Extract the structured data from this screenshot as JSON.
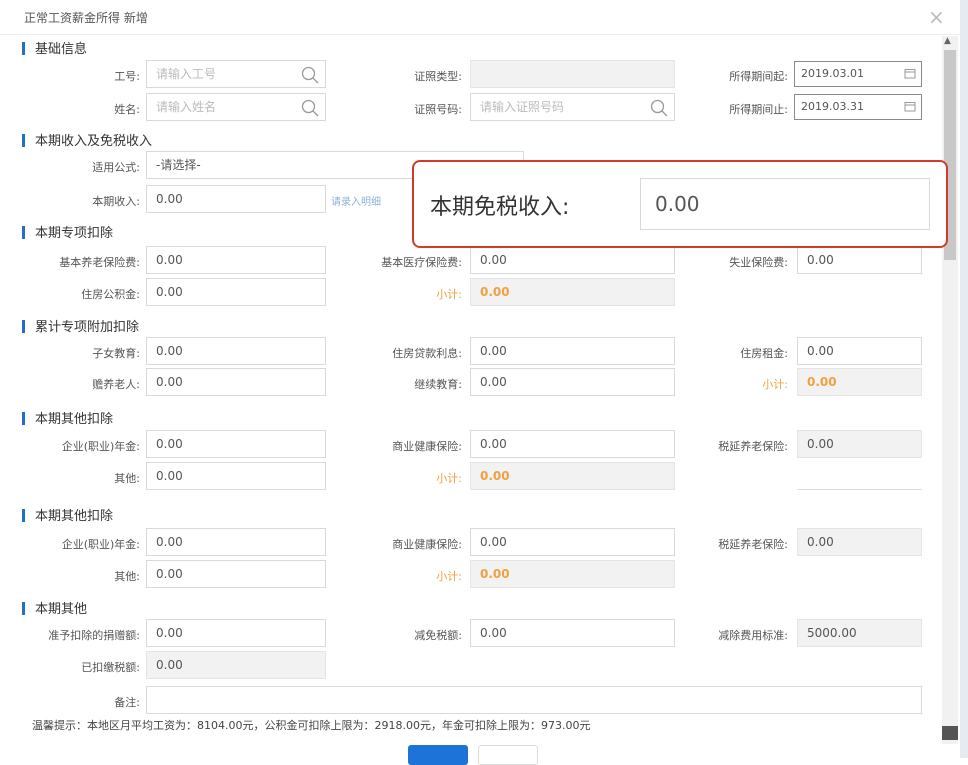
{
  "dialog": {
    "title": "正常工资薪金所得 新增"
  },
  "basic": {
    "heading": "基础信息",
    "emp_no_label": "工号:",
    "emp_no_placeholder": "请输入工号",
    "name_label": "姓名:",
    "name_placeholder": "请输入姓名",
    "id_type_label": "证照类型:",
    "id_no_label": "证照号码:",
    "id_no_placeholder": "请输入证照号码",
    "period_start_label": "所得期间起:",
    "period_start": "2019.03.01",
    "period_end_label": "所得期间止:",
    "period_end": "2019.03.31"
  },
  "income": {
    "heading": "本期收入及免税收入",
    "formula_label": "适用公式:",
    "formula_value": "-请选择-",
    "income_label": "本期收入:",
    "income_value": "0.00",
    "detail_btn": "请录入明细"
  },
  "highlight": {
    "label": "本期免税收入:",
    "value": "0.00"
  },
  "special": {
    "heading": "本期专项扣除",
    "pension_label": "基本养老保险费:",
    "pension": "0.00",
    "medical_label": "基本医疗保险费:",
    "medical": "0.00",
    "unemployment_label": "失业保险费:",
    "unemployment": "0.00",
    "housing_fund_label": "住房公积金:",
    "housing_fund": "0.00",
    "subtotal_label": "小计:",
    "subtotal": "0.00"
  },
  "additional": {
    "heading": "累计专项附加扣除",
    "children_label": "子女教育:",
    "children": "0.00",
    "loan_label": "住房贷款利息:",
    "loan": "0.00",
    "rent_label": "住房租金:",
    "rent": "0.00",
    "elderly_label": "赡养老人:",
    "elderly": "0.00",
    "continuing_label": "继续教育:",
    "continuing": "0.00",
    "subtotal_label": "小计:",
    "subtotal": "0.00"
  },
  "other1": {
    "heading": "本期其他扣除",
    "annuity_label": "企业(职业)年金:",
    "annuity": "0.00",
    "health_label": "商业健康保险:",
    "health": "0.00",
    "tax_deferred_label": "税延养老保险:",
    "tax_deferred": "0.00",
    "other_label": "其他:",
    "other": "0.00",
    "subtotal_label": "小计:",
    "subtotal": "0.00"
  },
  "other2": {
    "heading": "本期其他扣除",
    "annuity_label": "企业(职业)年金:",
    "annuity": "0.00",
    "health_label": "商业健康保险:",
    "health": "0.00",
    "tax_deferred_label": "税延养老保险:",
    "tax_deferred": "0.00",
    "other_label": "其他:",
    "other": "0.00",
    "subtotal_label": "小计:",
    "subtotal": "0.00"
  },
  "misc": {
    "heading": "本期其他",
    "donation_label": "准予扣除的捐赠额:",
    "donation": "0.00",
    "tax_relief_label": "减免税额:",
    "tax_relief": "0.00",
    "deduction_std_label": "减除费用标准:",
    "deduction_std": "5000.00",
    "paid_tax_label": "已扣缴税额:",
    "paid_tax": "0.00",
    "remark_label": "备注:",
    "remark": ""
  },
  "note": "温馨提示：本地区月平均工资为：8104.00元，公积金可扣除上限为：2918.00元，年金可扣除上限为：973.00元",
  "colors": {
    "accent": "#1f6fd1",
    "highlight_border": "#d33a2a",
    "subtotal": "#f0a040"
  }
}
